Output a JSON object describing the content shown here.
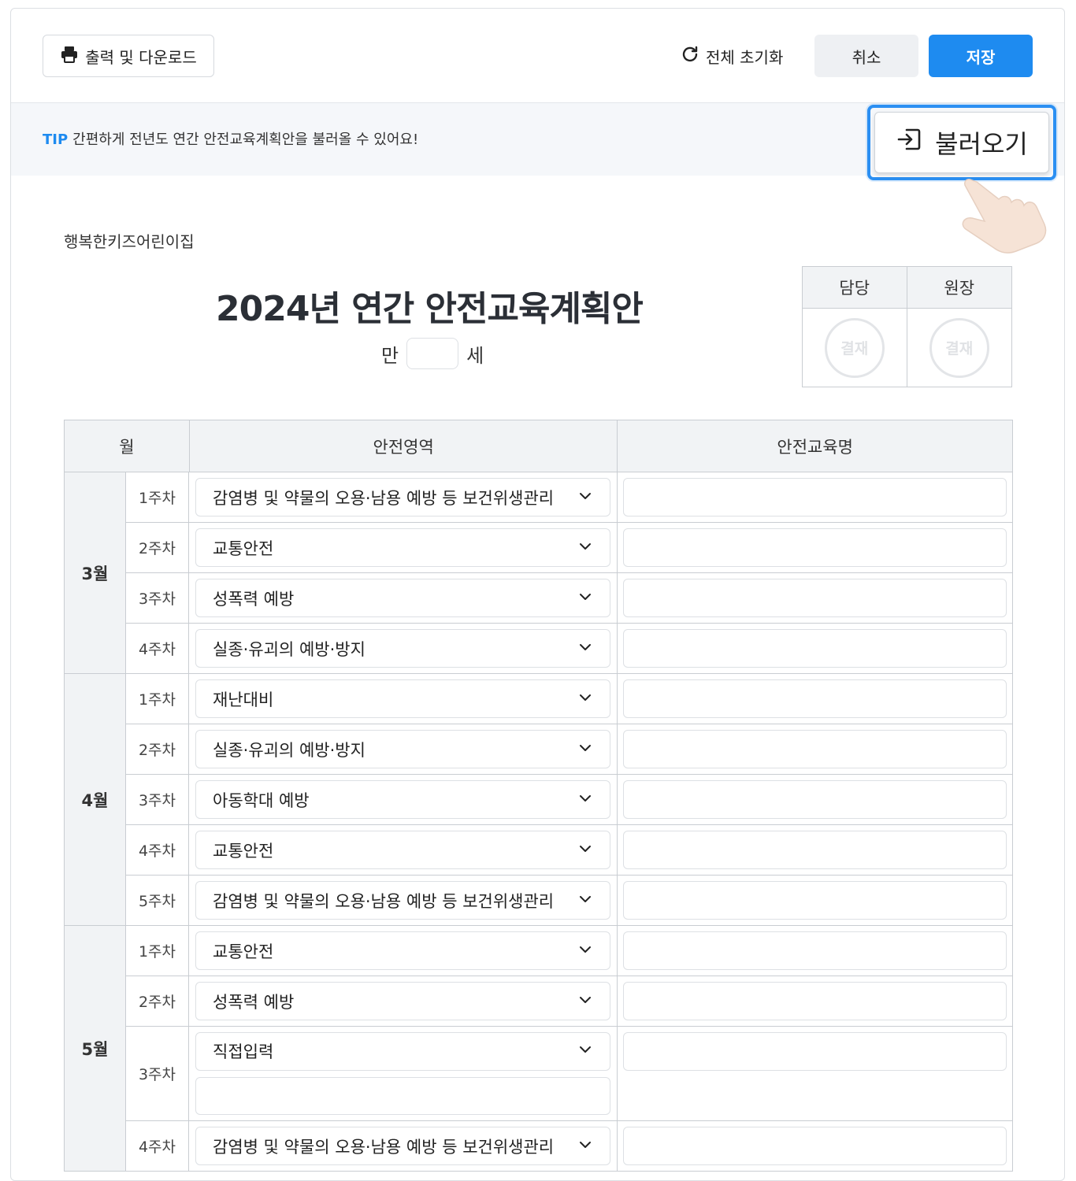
{
  "toolbar": {
    "print_label": "출력 및 다운로드",
    "reset_label": "전체 초기화",
    "cancel_label": "취소",
    "save_label": "저장"
  },
  "tip": {
    "label": "TIP",
    "text": "간편하게 전년도 연간 안전교육계획안을 불러올 수 있어요!",
    "load_label": "불러오기"
  },
  "doc": {
    "center_name": "행복한키즈어린이집",
    "title": "2024년 연간 안전교육계획안",
    "age_prefix": "만",
    "age_value": "",
    "age_suffix": "세"
  },
  "approval": {
    "col1": "담당",
    "col2": "원장",
    "stamp": "결재"
  },
  "table": {
    "headers": {
      "month": "월",
      "area": "안전영역",
      "name": "안전교육명"
    },
    "months": [
      {
        "label": "3월",
        "weeks": [
          {
            "week": "1주차",
            "area": "감염병 및 약물의 오용·남용 예방 등 보건위생관리",
            "name": ""
          },
          {
            "week": "2주차",
            "area": "교통안전",
            "name": ""
          },
          {
            "week": "3주차",
            "area": "성폭력 예방",
            "name": ""
          },
          {
            "week": "4주차",
            "area": "실종·유괴의 예방·방지",
            "name": ""
          }
        ]
      },
      {
        "label": "4월",
        "weeks": [
          {
            "week": "1주차",
            "area": "재난대비",
            "name": ""
          },
          {
            "week": "2주차",
            "area": "실종·유괴의 예방·방지",
            "name": ""
          },
          {
            "week": "3주차",
            "area": "아동학대 예방",
            "name": ""
          },
          {
            "week": "4주차",
            "area": "교통안전",
            "name": ""
          },
          {
            "week": "5주차",
            "area": "감염병 및 약물의 오용·남용 예방 등 보건위생관리",
            "name": ""
          }
        ]
      },
      {
        "label": "5월",
        "weeks": [
          {
            "week": "1주차",
            "area": "교통안전",
            "name": ""
          },
          {
            "week": "2주차",
            "area": "성폭력 예방",
            "name": ""
          },
          {
            "week": "3주차",
            "area": "직접입력",
            "name": "",
            "custom": ""
          },
          {
            "week": "4주차",
            "area": "감염병 및 약물의 오용·남용 예방 등 보건위생관리",
            "name": ""
          }
        ]
      }
    ]
  },
  "colors": {
    "accent": "#1e8bf0",
    "header_bg": "#f1f3f5"
  }
}
